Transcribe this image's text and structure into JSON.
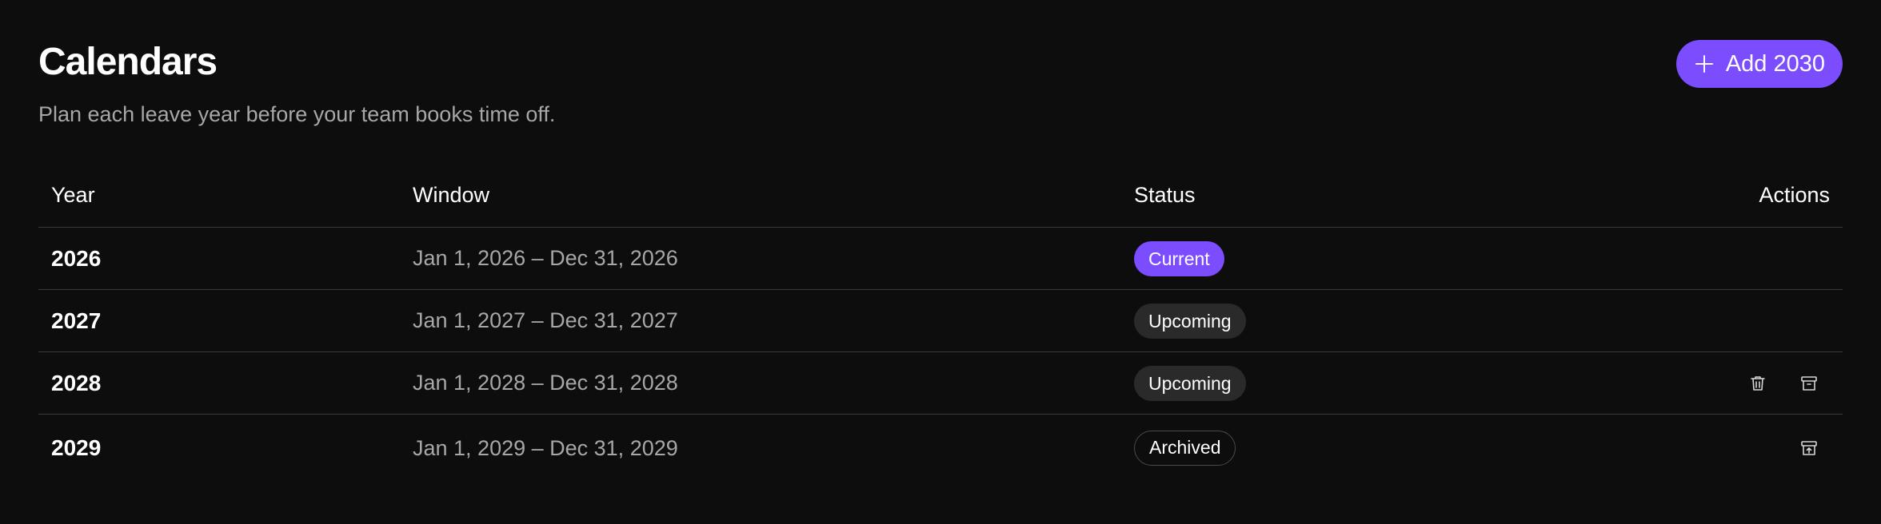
{
  "header": {
    "title": "Calendars",
    "subtitle": "Plan each leave year before your team books time off.",
    "add_button_label": "Add 2030"
  },
  "table": {
    "columns": {
      "year": "Year",
      "window": "Window",
      "status": "Status",
      "actions": "Actions"
    },
    "rows": [
      {
        "year": "2026",
        "window": "Jan 1, 2026 – Dec 31, 2026",
        "status": "Current",
        "actions": []
      },
      {
        "year": "2027",
        "window": "Jan 1, 2027 – Dec 31, 2027",
        "status": "Upcoming",
        "actions": []
      },
      {
        "year": "2028",
        "window": "Jan 1, 2028 – Dec 31, 2028",
        "status": "Upcoming",
        "actions": [
          "trash-icon",
          "archive-icon"
        ]
      },
      {
        "year": "2029",
        "window": "Jan 1, 2029 – Dec 31, 2029",
        "status": "Archived",
        "actions": [
          "unarchive-icon"
        ]
      }
    ]
  },
  "colors": {
    "background": "#0d0d0d",
    "accent": "#7c4dff",
    "muted_text": "#a7a7a7",
    "divider": "#3a3a3a",
    "upcoming_badge": "#2a2a2a"
  }
}
